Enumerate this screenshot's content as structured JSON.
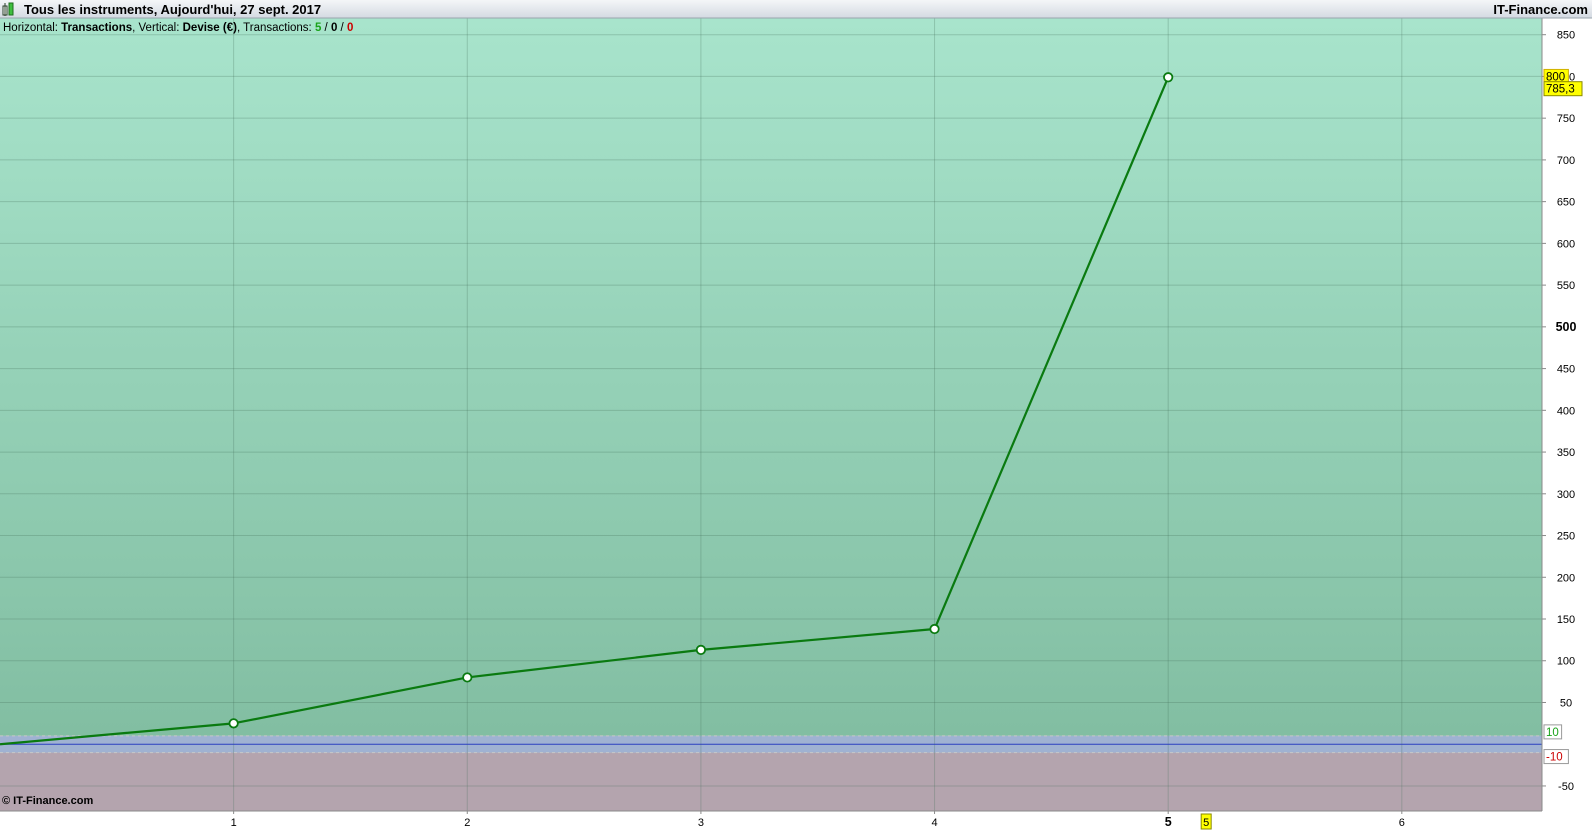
{
  "header": {
    "title": "Tous les instruments, Aujourd'hui, 27 sept. 2017",
    "brand": "IT-Finance.com",
    "info_horizontal_label": "Horizontal: ",
    "info_horizontal_value": "Transactions",
    "info_vertical_label": ", Vertical: ",
    "info_vertical_value": "Devise (€)",
    "info_transactions_label": ", Transactions: ",
    "info_count_total": "5",
    "info_separator_1": " / ",
    "info_count_neutral": "0",
    "info_separator_2": " / ",
    "info_count_loss": "0"
  },
  "footer": {
    "copyright": "© IT-Finance.com"
  },
  "colors": {
    "profit_zone_top": "#a8e4cc",
    "profit_zone_bottom": "#82bea2",
    "loss_zone": "#b4a4ae",
    "line": "#0a7a10",
    "zero_band": "#9fb2d2",
    "zero_line": "#2a3fbf",
    "label_highlight": "#ffff00",
    "count_total": "#1aa31a",
    "count_loss": "#cc0000"
  },
  "chart_data": {
    "type": "line",
    "x": [
      0,
      1,
      2,
      3,
      4,
      5
    ],
    "values": [
      0,
      25,
      80,
      113,
      138,
      799
    ],
    "xlim": [
      0,
      6.6
    ],
    "ylim": [
      -80,
      870
    ],
    "x_ticks": [
      "1",
      "2",
      "3",
      "4",
      "5",
      "6"
    ],
    "x_tick_bold": "5",
    "y_ticks": [
      "850",
      "800",
      "750",
      "700",
      "650",
      "600",
      "550",
      "500",
      "450",
      "400",
      "350",
      "300",
      "250",
      "200",
      "150",
      "100",
      "50",
      "-50"
    ],
    "y_tick_bold": "500",
    "threshold_upper": {
      "value": 10,
      "label": "10"
    },
    "threshold_lower": {
      "value": -10,
      "label": "-10"
    },
    "last_value_label": "785,3",
    "highlight_y_label": "800",
    "highlight_x_label": "5",
    "grid": true
  }
}
